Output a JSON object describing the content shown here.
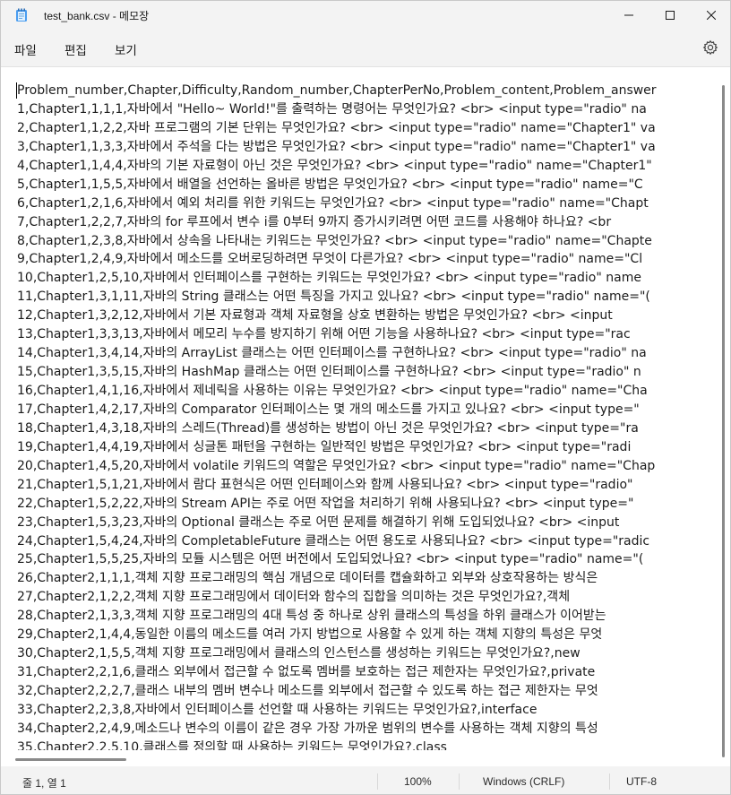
{
  "window": {
    "title": "test_bank.csv - 메모장"
  },
  "menu": {
    "file": "파일",
    "edit": "편집",
    "view": "보기",
    "settings_icon": "gear-icon"
  },
  "editor": {
    "lines": [
      "Problem_number,Chapter,Difficulty,Random_number,ChapterPerNo,Problem_content,Problem_answer",
      "1,Chapter1,1,1,1,자바에서 \"Hello~ World!\"를 출력하는 명령어는 무엇인가요? <br> <input type=\"radio\" na",
      "2,Chapter1,1,2,2,자바 프로그램의 기본 단위는 무엇인가요? <br> <input type=\"radio\" name=\"Chapter1\" va",
      "3,Chapter1,1,3,3,자바에서 주석을 다는 방법은 무엇인가요? <br> <input type=\"radio\" name=\"Chapter1\" va",
      "4,Chapter1,1,4,4,자바의 기본 자료형이 아닌 것은 무엇인가요? <br> <input type=\"radio\" name=\"Chapter1\"",
      "5,Chapter1,1,5,5,자바에서 배열을 선언하는 올바른 방법은 무엇인가요? <br> <input type=\"radio\" name=\"C",
      "6,Chapter1,2,1,6,자바에서 예외 처리를 위한 키워드는 무엇인가요? <br> <input type=\"radio\" name=\"Chapt",
      "7,Chapter1,2,2,7,자바의 for 루프에서 변수 i를 0부터 9까지 증가시키려면 어떤 코드를 사용해야 하나요? <br",
      "8,Chapter1,2,3,8,자바에서 상속을 나타내는 키워드는 무엇인가요? <br> <input type=\"radio\" name=\"Chapte",
      "9,Chapter1,2,4,9,자바에서 메소드를 오버로딩하려면 무엇이 다른가요? <br> <input type=\"radio\" name=\"Cl",
      "10,Chapter1,2,5,10,자바에서 인터페이스를 구현하는 키워드는 무엇인가요? <br> <input type=\"radio\" name",
      "11,Chapter1,3,1,11,자바의 String 클래스는 어떤 특징을 가지고 있나요? <br> <input type=\"radio\" name=\"(",
      "12,Chapter1,3,2,12,자바에서 기본 자료형과 객체 자료형을 상호 변환하는 방법은 무엇인가요? <br> <input",
      "13,Chapter1,3,3,13,자바에서 메모리 누수를 방지하기 위해 어떤 기능을 사용하나요? <br> <input type=\"rac",
      "14,Chapter1,3,4,14,자바의 ArrayList 클래스는 어떤 인터페이스를 구현하나요? <br> <input type=\"radio\" na",
      "15,Chapter1,3,5,15,자바의 HashMap 클래스는 어떤 인터페이스를 구현하나요? <br> <input type=\"radio\" n",
      "16,Chapter1,4,1,16,자바에서 제네릭을 사용하는 이유는 무엇인가요? <br> <input type=\"radio\" name=\"Cha",
      "17,Chapter1,4,2,17,자바의 Comparator 인터페이스는 몇 개의 메소드를 가지고 있나요? <br> <input type=\"",
      "18,Chapter1,4,3,18,자바의 스레드(Thread)를 생성하는 방법이 아닌 것은 무엇인가요? <br> <input type=\"ra",
      "19,Chapter1,4,4,19,자바에서 싱글톤 패턴을 구현하는 일반적인 방법은 무엇인가요? <br> <input type=\"radi",
      "20,Chapter1,4,5,20,자바에서 volatile 키워드의 역할은 무엇인가요? <br> <input type=\"radio\" name=\"Chap",
      "21,Chapter1,5,1,21,자바에서 람다 표현식은 어떤 인터페이스와 함께 사용되나요? <br> <input type=\"radio\"",
      "22,Chapter1,5,2,22,자바의 Stream API는 주로 어떤 작업을 처리하기 위해 사용되나요? <br> <input type=\"",
      "23,Chapter1,5,3,23,자바의 Optional 클래스는 주로 어떤 문제를 해결하기 위해 도입되었나요? <br> <input",
      "24,Chapter1,5,4,24,자바의 CompletableFuture 클래스는 어떤 용도로 사용되나요? <br> <input type=\"radic",
      "25,Chapter1,5,5,25,자바의 모듈 시스템은 어떤 버전에서 도입되었나요? <br> <input type=\"radio\" name=\"(",
      "26,Chapter2,1,1,1,객체 지향 프로그래밍의 핵심 개념으로 데이터를 캡슐화하고 외부와 상호작용하는 방식은",
      "27,Chapter2,1,2,2,객체 지향 프로그래밍에서 데이터와 함수의 집합을 의미하는 것은 무엇인가요?,객체",
      "28,Chapter2,1,3,3,객체 지향 프로그래밍의 4대 특성 중 하나로 상위 클래스의 특성을 하위 클래스가 이어받는",
      "29,Chapter2,1,4,4,동일한 이름의 메소드를 여러 가지 방법으로 사용할 수 있게 하는 객체 지향의 특성은 무엇",
      "30,Chapter2,1,5,5,객체 지향 프로그래밍에서 클래스의 인스턴스를 생성하는 키워드는 무엇인가요?,new",
      "31,Chapter2,2,1,6,클래스 외부에서 접근할 수 없도록 멤버를 보호하는 접근 제한자는 무엇인가요?,private",
      "32,Chapter2,2,2,7,클래스 내부의 멤버 변수나 메소드를 외부에서 접근할 수 있도록 하는 접근 제한자는 무엇",
      "33,Chapter2,2,3,8,자바에서 인터페이스를 선언할 때 사용하는 키워드는 무엇인가요?,interface",
      "34,Chapter2,2,4,9,메소드나 변수의 이름이 같은 경우 가장 가까운 범위의 변수를 사용하는 객체 지향의 특성",
      "35,Chapter2,2,5,10,클래스를 정의할 때 사용하는 키워드는 무엇인가요?,class"
    ]
  },
  "status": {
    "position": "줄 1, 열 1",
    "zoom": "100%",
    "line_ending": "Windows (CRLF)",
    "encoding": "UTF-8"
  }
}
